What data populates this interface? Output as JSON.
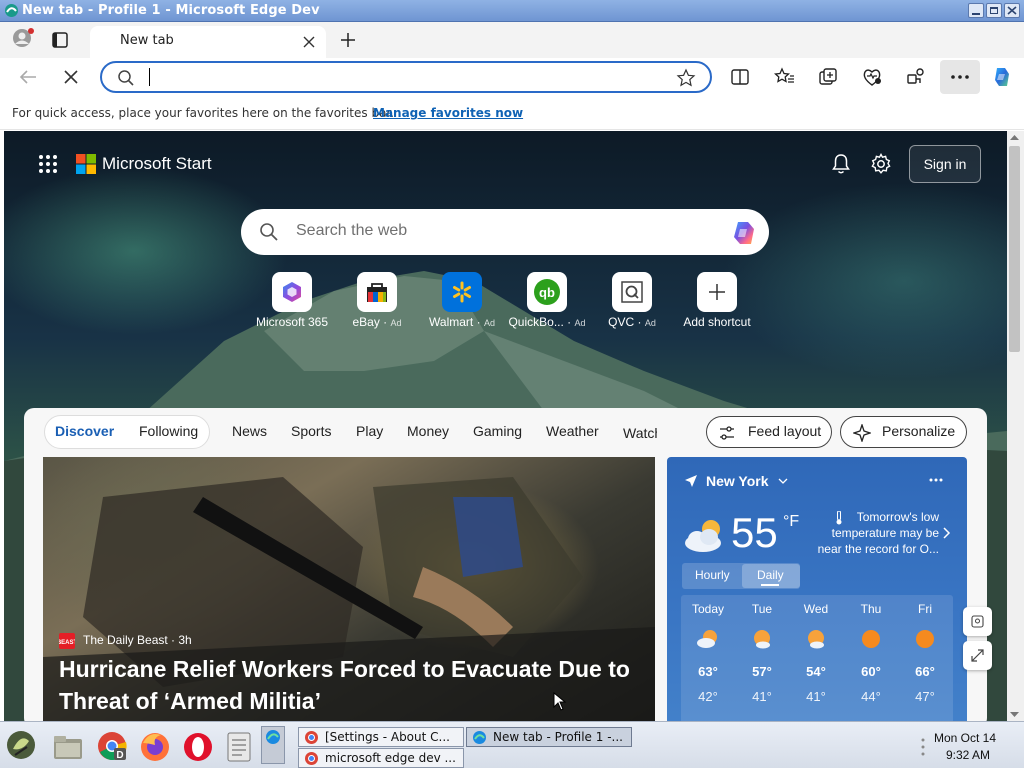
{
  "window": {
    "title": "New tab - Profile 1 - Microsoft Edge Dev"
  },
  "tabs": [
    {
      "label": "New tab",
      "active": true
    }
  ],
  "address_bar": {
    "value": "",
    "placeholder": ""
  },
  "favorites_bar": {
    "text": "For quick access, place your favorites here on the favorites bar.",
    "link": "Manage favorites now"
  },
  "start": {
    "brand": "Microsoft Start",
    "sign_in": "Sign in",
    "search_placeholder": "Search the web",
    "shortcuts": [
      {
        "label": "Microsoft 365",
        "ad": ""
      },
      {
        "label": "eBay",
        "ad": "Ad"
      },
      {
        "label": "Walmart",
        "ad": "Ad"
      },
      {
        "label": "QuickBo...",
        "ad": "Ad"
      },
      {
        "label": "QVC",
        "ad": "Ad"
      },
      {
        "label": "Add shortcut",
        "ad": ""
      }
    ]
  },
  "feed": {
    "nav": [
      "Discover",
      "Following",
      "News",
      "Sports",
      "Play",
      "Money",
      "Gaming",
      "Weather",
      "Watch"
    ],
    "feed_layout": "Feed layout",
    "personalize": "Personalize",
    "hero": {
      "source": "The Daily Beast",
      "age": "3h",
      "title": "Hurricane Relief Workers Forced to Evacuate Due to Threat of ‘Armed Militia’"
    }
  },
  "weather": {
    "location": "New York",
    "temp": "55",
    "unit": "°F",
    "alert": "Tomorrow's low temperature may be near the record for O...",
    "tabs": [
      "Hourly",
      "Daily"
    ],
    "days": [
      {
        "day": "Today",
        "hi": "63°",
        "lo": "42°"
      },
      {
        "day": "Tue",
        "hi": "57°",
        "lo": "41°"
      },
      {
        "day": "Wed",
        "hi": "54°",
        "lo": "41°"
      },
      {
        "day": "Thu",
        "hi": "60°",
        "lo": "44°"
      },
      {
        "day": "Fri",
        "hi": "66°",
        "lo": "47°"
      }
    ]
  },
  "taskbar": {
    "buttons": [
      "[Settings - About C...",
      "New tab - Profile 1 -...",
      "microsoft edge dev ..."
    ],
    "clock_date": "Mon Oct 14",
    "clock_time": "9:32 AM"
  },
  "colors": {
    "accent": "#2a6ac8",
    "link": "#0f62b4",
    "weather_bg": "#3a76c4"
  }
}
